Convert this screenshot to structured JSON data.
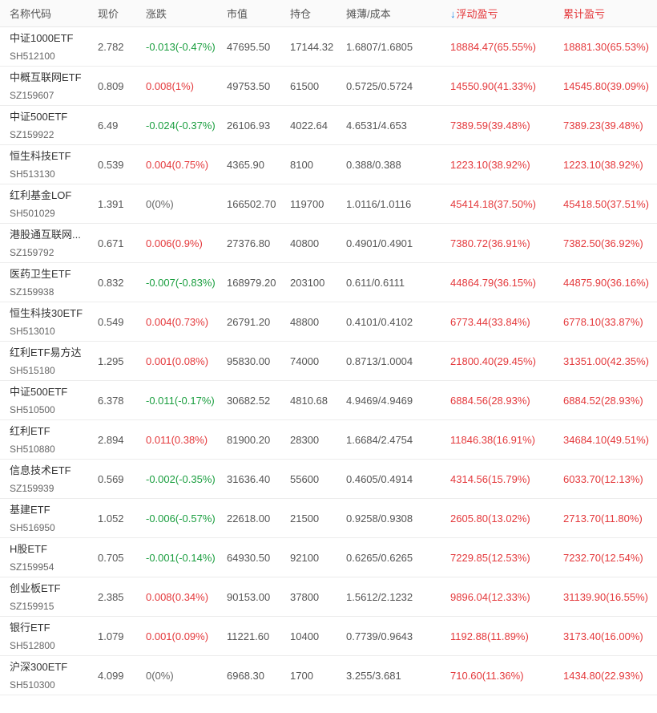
{
  "colors": {
    "up": "#e4393c",
    "down": "#1a9e3f",
    "flat": "#666666",
    "sort_arrow": "#1e88e5"
  },
  "header": {
    "name": "名称代码",
    "price": "现价",
    "change": "涨跌",
    "market_value": "市值",
    "position": "持仓",
    "cost": "摊薄/成本",
    "float_pnl": "浮动盈亏",
    "total_pnl": "累计盈亏",
    "sort_icon": "arrow-down-icon",
    "sort_column": "float_pnl",
    "sort_direction": "desc"
  },
  "rows": [
    {
      "name": "中证1000ETF",
      "code": "SH512100",
      "price": "2.782",
      "change": "-0.013(-0.47%)",
      "trend": "down",
      "market_value": "47695.50",
      "position": "17144.32",
      "cost": "1.6807/1.6805",
      "float_pnl": "18884.47(65.55%)",
      "total_pnl": "18881.30(65.53%)"
    },
    {
      "name": "中概互联网ETF",
      "code": "SZ159607",
      "price": "0.809",
      "change": "0.008(1%)",
      "trend": "up",
      "market_value": "49753.50",
      "position": "61500",
      "cost": "0.5725/0.5724",
      "float_pnl": "14550.90(41.33%)",
      "total_pnl": "14545.80(39.09%)"
    },
    {
      "name": "中证500ETF",
      "code": "SZ159922",
      "price": "6.49",
      "change": "-0.024(-0.37%)",
      "trend": "down",
      "market_value": "26106.93",
      "position": "4022.64",
      "cost": "4.6531/4.653",
      "float_pnl": "7389.59(39.48%)",
      "total_pnl": "7389.23(39.48%)"
    },
    {
      "name": "恒生科技ETF",
      "code": "SH513130",
      "price": "0.539",
      "change": "0.004(0.75%)",
      "trend": "up",
      "market_value": "4365.90",
      "position": "8100",
      "cost": "0.388/0.388",
      "float_pnl": "1223.10(38.92%)",
      "total_pnl": "1223.10(38.92%)"
    },
    {
      "name": "红利基金LOF",
      "code": "SH501029",
      "price": "1.391",
      "change": "0(0%)",
      "trend": "flat",
      "market_value": "166502.70",
      "position": "119700",
      "cost": "1.0116/1.0116",
      "float_pnl": "45414.18(37.50%)",
      "total_pnl": "45418.50(37.51%)"
    },
    {
      "name": "港股通互联网...",
      "code": "SZ159792",
      "price": "0.671",
      "change": "0.006(0.9%)",
      "trend": "up",
      "market_value": "27376.80",
      "position": "40800",
      "cost": "0.4901/0.4901",
      "float_pnl": "7380.72(36.91%)",
      "total_pnl": "7382.50(36.92%)"
    },
    {
      "name": "医药卫生ETF",
      "code": "SZ159938",
      "price": "0.832",
      "change": "-0.007(-0.83%)",
      "trend": "down",
      "market_value": "168979.20",
      "position": "203100",
      "cost": "0.611/0.6111",
      "float_pnl": "44864.79(36.15%)",
      "total_pnl": "44875.90(36.16%)"
    },
    {
      "name": "恒生科技30ETF",
      "code": "SH513010",
      "price": "0.549",
      "change": "0.004(0.73%)",
      "trend": "up",
      "market_value": "26791.20",
      "position": "48800",
      "cost": "0.4101/0.4102",
      "float_pnl": "6773.44(33.84%)",
      "total_pnl": "6778.10(33.87%)"
    },
    {
      "name": "红利ETF易方达",
      "code": "SH515180",
      "price": "1.295",
      "change": "0.001(0.08%)",
      "trend": "up",
      "market_value": "95830.00",
      "position": "74000",
      "cost": "0.8713/1.0004",
      "float_pnl": "21800.40(29.45%)",
      "total_pnl": "31351.00(42.35%)"
    },
    {
      "name": "中证500ETF",
      "code": "SH510500",
      "price": "6.378",
      "change": "-0.011(-0.17%)",
      "trend": "down",
      "market_value": "30682.52",
      "position": "4810.68",
      "cost": "4.9469/4.9469",
      "float_pnl": "6884.56(28.93%)",
      "total_pnl": "6884.52(28.93%)"
    },
    {
      "name": "红利ETF",
      "code": "SH510880",
      "price": "2.894",
      "change": "0.011(0.38%)",
      "trend": "up",
      "market_value": "81900.20",
      "position": "28300",
      "cost": "1.6684/2.4754",
      "float_pnl": "11846.38(16.91%)",
      "total_pnl": "34684.10(49.51%)"
    },
    {
      "name": "信息技术ETF",
      "code": "SZ159939",
      "price": "0.569",
      "change": "-0.002(-0.35%)",
      "trend": "down",
      "market_value": "31636.40",
      "position": "55600",
      "cost": "0.4605/0.4914",
      "float_pnl": "4314.56(15.79%)",
      "total_pnl": "6033.70(12.13%)"
    },
    {
      "name": "基建ETF",
      "code": "SH516950",
      "price": "1.052",
      "change": "-0.006(-0.57%)",
      "trend": "down",
      "market_value": "22618.00",
      "position": "21500",
      "cost": "0.9258/0.9308",
      "float_pnl": "2605.80(13.02%)",
      "total_pnl": "2713.70(11.80%)"
    },
    {
      "name": "H股ETF",
      "code": "SZ159954",
      "price": "0.705",
      "change": "-0.001(-0.14%)",
      "trend": "down",
      "market_value": "64930.50",
      "position": "92100",
      "cost": "0.6265/0.6265",
      "float_pnl": "7229.85(12.53%)",
      "total_pnl": "7232.70(12.54%)"
    },
    {
      "name": "创业板ETF",
      "code": "SZ159915",
      "price": "2.385",
      "change": "0.008(0.34%)",
      "trend": "up",
      "market_value": "90153.00",
      "position": "37800",
      "cost": "1.5612/2.1232",
      "float_pnl": "9896.04(12.33%)",
      "total_pnl": "31139.90(16.55%)"
    },
    {
      "name": "银行ETF",
      "code": "SH512800",
      "price": "1.079",
      "change": "0.001(0.09%)",
      "trend": "up",
      "market_value": "11221.60",
      "position": "10400",
      "cost": "0.7739/0.9643",
      "float_pnl": "1192.88(11.89%)",
      "total_pnl": "3173.40(16.00%)"
    },
    {
      "name": "沪深300ETF",
      "code": "SH510300",
      "price": "4.099",
      "change": "0(0%)",
      "trend": "flat",
      "market_value": "6968.30",
      "position": "1700",
      "cost": "3.255/3.681",
      "float_pnl": "710.60(11.36%)",
      "total_pnl": "1434.80(22.93%)"
    }
  ]
}
